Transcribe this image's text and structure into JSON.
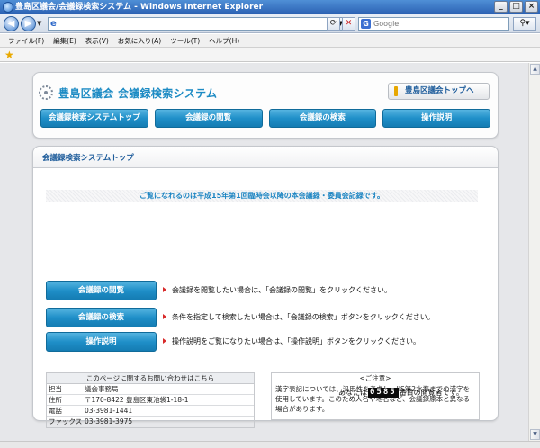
{
  "browser": {
    "window_title": "豊島区議会/会議録検索システム - Windows Internet Explorer",
    "search_placeholder": "Google",
    "menu": [
      "ファイル(F)",
      "編集(E)",
      "表示(V)",
      "お気に入り(A)",
      "ツール(T)",
      "ヘルプ(H)"
    ]
  },
  "header": {
    "site_title": "豊島区議会 会議録検索システム",
    "assembly_top_button": "豊島区議会トップへ",
    "nav": [
      "会議録検索システムトップ",
      "会議録の閲覧",
      "会議録の検索",
      "操作説明"
    ]
  },
  "main": {
    "section_title": "会議録検索システムトップ",
    "notice": "ご覧になれるのは平成15年第1回臨時会以降の本会議録・委員会記録です。",
    "actions": [
      {
        "label": "会議録の閲覧",
        "desc": "会議録を閲覧したい場合は、「会議録の閲覧」をクリックください。"
      },
      {
        "label": "会議録の検索",
        "desc": "条件を指定して検索したい場合は、「会議録の検索」ボタンをクリックください。"
      },
      {
        "label": "操作説明",
        "desc": "操作説明をご覧になりたい場合は、「操作説明」ボタンをクリックください。"
      }
    ],
    "contact": {
      "caption": "このページに関するお問い合わせはこちら",
      "rows": [
        {
          "k": "担当",
          "v": "議会事務局"
        },
        {
          "k": "住所",
          "v": "〒170-8422 豊島区東池袋1-18-1"
        },
        {
          "k": "電話",
          "v": "03-3981-1441"
        },
        {
          "k": "ファックス",
          "v": "03-3981-3975"
        }
      ]
    },
    "caution": {
      "caption": "<ご注意>",
      "body": "漢字表記については、汎用性を考慮し、JIS第2水準までの漢字を使用しています。このため人名や地名など、会議録原本と異なる場合があります。"
    },
    "counter": {
      "prefix": "あなたは",
      "count": "0585",
      "suffix": "番目の閲覧者です。"
    }
  }
}
